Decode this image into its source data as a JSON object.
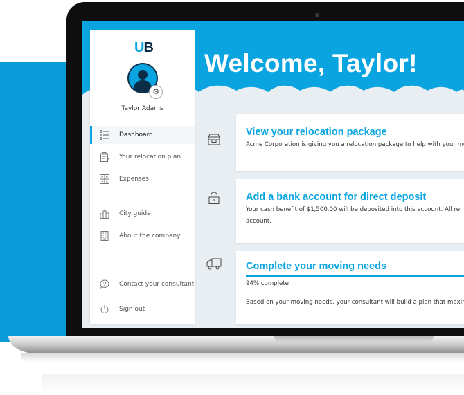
{
  "app": {
    "logo_accent": "U",
    "logo_rest": "B"
  },
  "header": {
    "welcome": "Welcome, Taylor!"
  },
  "user": {
    "name": "Taylor Adams"
  },
  "sidebar": {
    "items": [
      {
        "label": "Dashboard",
        "icon": "dashboard-list-icon",
        "active": true
      },
      {
        "label": "Your relocation plan",
        "icon": "clipboard-icon"
      },
      {
        "label": "Expenses",
        "icon": "expenses-grid-icon"
      },
      {
        "label": "City guide",
        "icon": "city-buildings-icon"
      },
      {
        "label": "About the company",
        "icon": "office-building-icon"
      },
      {
        "label": "Contact your consultant",
        "icon": "chat-question-icon"
      },
      {
        "label": "Sign out",
        "icon": "power-icon"
      }
    ]
  },
  "cards": [
    {
      "title": "View your relocation package",
      "text": "Acme Corporation is giving you a relocation package to help with your mo",
      "icon": "package-box-icon"
    },
    {
      "title": "Add a bank account for direct deposit",
      "text1": "Your cash benefit of $1,500.00 will be deposited into this account. All rei",
      "text2": "account.",
      "icon": "lock-icon"
    },
    {
      "title": "Complete your moving needs",
      "progress_text": "94% complete",
      "progress": 0.94,
      "text": "Based on your moving needs, your consultant will build a plan that maximi",
      "icon": "moving-truck-icon"
    }
  ],
  "colors": {
    "accent": "#0aa5e0",
    "accent_dark": "#0a9ad8",
    "navy": "#0b2a4a"
  }
}
